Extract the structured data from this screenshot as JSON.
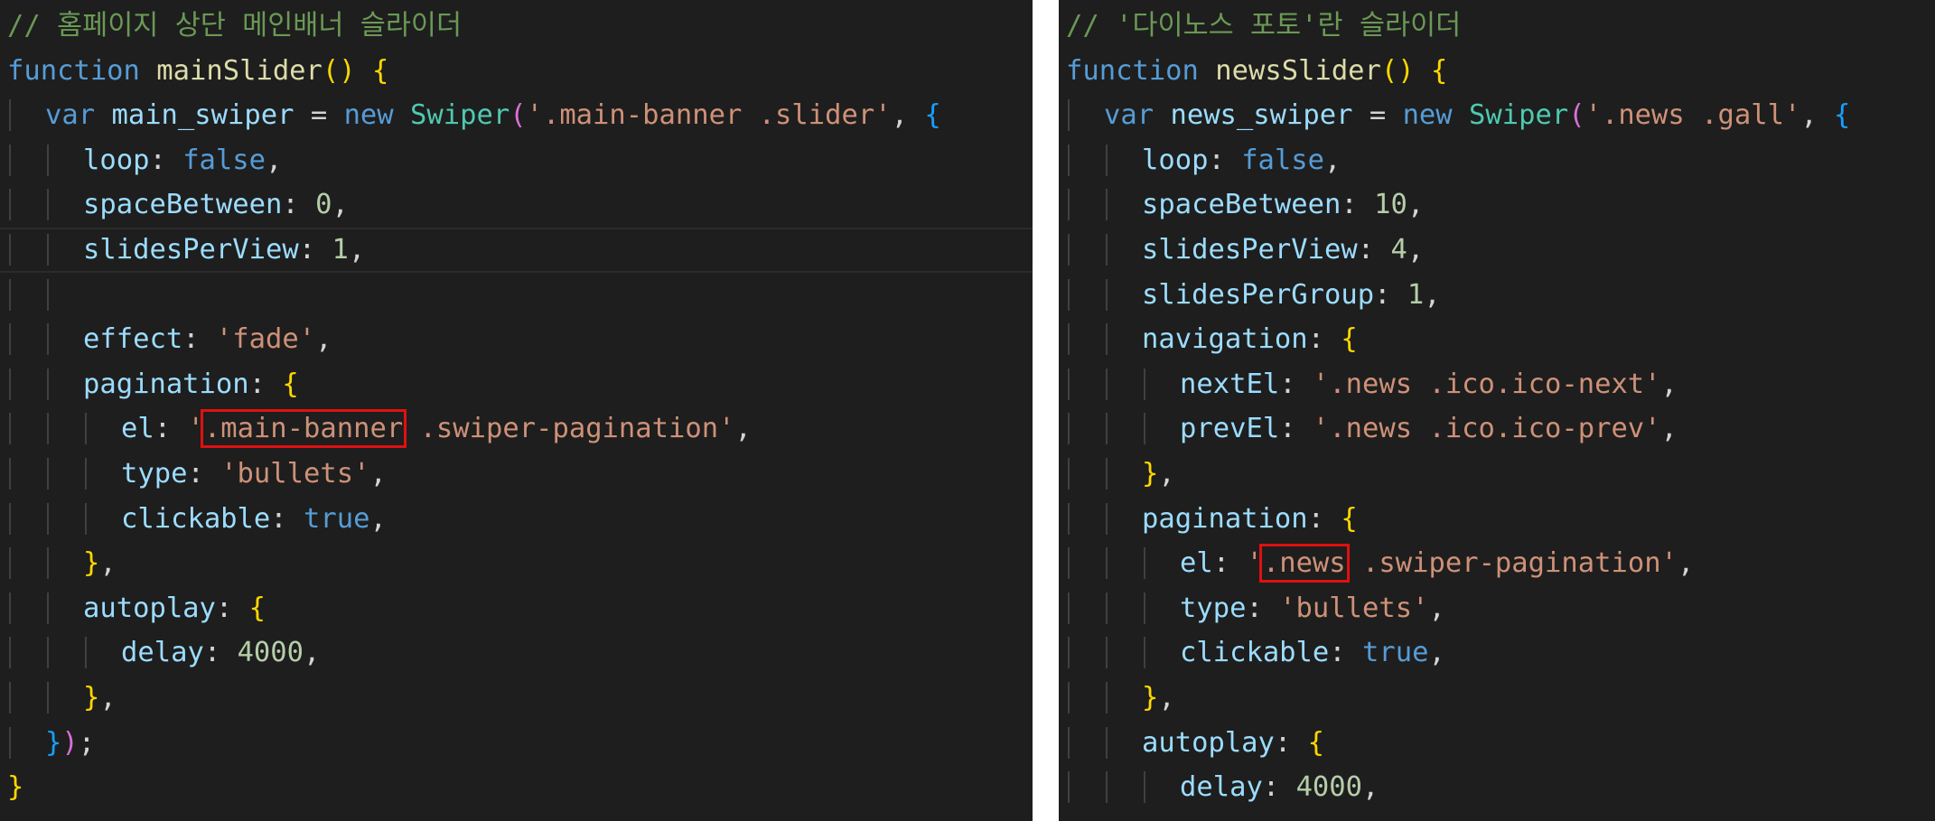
{
  "colors": {
    "background": "#1e1e1e",
    "comment": "#6a9955",
    "keyword": "#569cd6",
    "function": "#dcdcaa",
    "variable": "#9cdcfe",
    "string": "#ce9178",
    "number": "#b5cea8",
    "class": "#4ec9b0",
    "punctuation": "#d4d4d4",
    "bracket_level1": "#ffd700",
    "bracket_level2": "#da70d6",
    "bracket_level3": "#179fff",
    "highlight_box": "#e01010"
  },
  "panels": [
    {
      "id": "main-slider",
      "lines": [
        {
          "indent": 0,
          "tokens": [
            {
              "t": "// 홈페이지 상단 메인배너 슬라이더",
              "c": "comment"
            }
          ]
        },
        {
          "indent": 0,
          "tokens": [
            {
              "t": "function",
              "c": "kw"
            },
            {
              "t": " ",
              "c": "plain"
            },
            {
              "t": "mainSlider",
              "c": "fn"
            },
            {
              "t": "()",
              "c": "b1"
            },
            {
              "t": " ",
              "c": "plain"
            },
            {
              "t": "{",
              "c": "b1"
            }
          ]
        },
        {
          "indent": 1,
          "tokens": [
            {
              "t": "var",
              "c": "kw"
            },
            {
              "t": " ",
              "c": "plain"
            },
            {
              "t": "main_swiper",
              "c": "var"
            },
            {
              "t": " = ",
              "c": "plain"
            },
            {
              "t": "new",
              "c": "kw"
            },
            {
              "t": " ",
              "c": "plain"
            },
            {
              "t": "Swiper",
              "c": "class"
            },
            {
              "t": "(",
              "c": "b2"
            },
            {
              "t": "'.main-banner .slider'",
              "c": "str"
            },
            {
              "t": ", ",
              "c": "plain"
            },
            {
              "t": "{",
              "c": "b3"
            }
          ]
        },
        {
          "indent": 2,
          "tokens": [
            {
              "t": "loop",
              "c": "var"
            },
            {
              "t": ": ",
              "c": "plain"
            },
            {
              "t": "false",
              "c": "kw"
            },
            {
              "t": ",",
              "c": "plain"
            }
          ]
        },
        {
          "indent": 2,
          "tokens": [
            {
              "t": "spaceBetween",
              "c": "var"
            },
            {
              "t": ": ",
              "c": "plain"
            },
            {
              "t": "0",
              "c": "num"
            },
            {
              "t": ",",
              "c": "plain"
            }
          ]
        },
        {
          "indent": 2,
          "current": true,
          "tokens": [
            {
              "t": "slidesPerView",
              "c": "var"
            },
            {
              "t": ": ",
              "c": "plain"
            },
            {
              "t": "1",
              "c": "num"
            },
            {
              "t": ",",
              "c": "plain"
            }
          ]
        },
        {
          "indent": 2,
          "tokens": []
        },
        {
          "indent": 2,
          "tokens": [
            {
              "t": "effect",
              "c": "var"
            },
            {
              "t": ": ",
              "c": "plain"
            },
            {
              "t": "'fade'",
              "c": "str"
            },
            {
              "t": ",",
              "c": "plain"
            }
          ]
        },
        {
          "indent": 2,
          "tokens": [
            {
              "t": "pagination",
              "c": "var"
            },
            {
              "t": ": ",
              "c": "plain"
            },
            {
              "t": "{",
              "c": "b1"
            }
          ]
        },
        {
          "indent": 3,
          "tokens": [
            {
              "t": "el",
              "c": "var"
            },
            {
              "t": ": ",
              "c": "plain"
            },
            {
              "t": "'",
              "c": "str"
            },
            {
              "t": ".main-banner",
              "c": "str",
              "hl": true
            },
            {
              "t": " .swiper-pagination'",
              "c": "str"
            },
            {
              "t": ",",
              "c": "plain"
            }
          ]
        },
        {
          "indent": 3,
          "tokens": [
            {
              "t": "type",
              "c": "var"
            },
            {
              "t": ": ",
              "c": "plain"
            },
            {
              "t": "'bullets'",
              "c": "str"
            },
            {
              "t": ",",
              "c": "plain"
            }
          ]
        },
        {
          "indent": 3,
          "tokens": [
            {
              "t": "clickable",
              "c": "var"
            },
            {
              "t": ": ",
              "c": "plain"
            },
            {
              "t": "true",
              "c": "kw"
            },
            {
              "t": ",",
              "c": "plain"
            }
          ]
        },
        {
          "indent": 2,
          "tokens": [
            {
              "t": "}",
              "c": "b1"
            },
            {
              "t": ",",
              "c": "plain"
            }
          ]
        },
        {
          "indent": 2,
          "tokens": [
            {
              "t": "autoplay",
              "c": "var"
            },
            {
              "t": ": ",
              "c": "plain"
            },
            {
              "t": "{",
              "c": "b1"
            }
          ]
        },
        {
          "indent": 3,
          "tokens": [
            {
              "t": "delay",
              "c": "var"
            },
            {
              "t": ": ",
              "c": "plain"
            },
            {
              "t": "4000",
              "c": "num"
            },
            {
              "t": ",",
              "c": "plain"
            }
          ]
        },
        {
          "indent": 2,
          "tokens": [
            {
              "t": "}",
              "c": "b1"
            },
            {
              "t": ",",
              "c": "plain"
            }
          ]
        },
        {
          "indent": 1,
          "tokens": [
            {
              "t": "}",
              "c": "b3"
            },
            {
              "t": ")",
              "c": "b2"
            },
            {
              "t": ";",
              "c": "plain"
            }
          ]
        },
        {
          "indent": 0,
          "tokens": [
            {
              "t": "}",
              "c": "b1"
            }
          ]
        }
      ]
    },
    {
      "id": "news-slider",
      "lines": [
        {
          "indent": 0,
          "tokens": [
            {
              "t": "// '다이노스 포토'란 슬라이더",
              "c": "comment"
            }
          ]
        },
        {
          "indent": 0,
          "tokens": [
            {
              "t": "function",
              "c": "kw"
            },
            {
              "t": " ",
              "c": "plain"
            },
            {
              "t": "newsSlider",
              "c": "fn"
            },
            {
              "t": "()",
              "c": "b1"
            },
            {
              "t": " ",
              "c": "plain"
            },
            {
              "t": "{",
              "c": "b1"
            }
          ]
        },
        {
          "indent": 1,
          "tokens": [
            {
              "t": "var",
              "c": "kw"
            },
            {
              "t": " ",
              "c": "plain"
            },
            {
              "t": "news_swiper",
              "c": "var"
            },
            {
              "t": " = ",
              "c": "plain"
            },
            {
              "t": "new",
              "c": "kw"
            },
            {
              "t": " ",
              "c": "plain"
            },
            {
              "t": "Swiper",
              "c": "class"
            },
            {
              "t": "(",
              "c": "b2"
            },
            {
              "t": "'.news .gall'",
              "c": "str"
            },
            {
              "t": ", ",
              "c": "plain"
            },
            {
              "t": "{",
              "c": "b3"
            }
          ]
        },
        {
          "indent": 2,
          "tokens": [
            {
              "t": "loop",
              "c": "var"
            },
            {
              "t": ": ",
              "c": "plain"
            },
            {
              "t": "false",
              "c": "kw"
            },
            {
              "t": ",",
              "c": "plain"
            }
          ]
        },
        {
          "indent": 2,
          "tokens": [
            {
              "t": "spaceBetween",
              "c": "var"
            },
            {
              "t": ": ",
              "c": "plain"
            },
            {
              "t": "10",
              "c": "num"
            },
            {
              "t": ",",
              "c": "plain"
            }
          ]
        },
        {
          "indent": 2,
          "tokens": [
            {
              "t": "slidesPerView",
              "c": "var"
            },
            {
              "t": ": ",
              "c": "plain"
            },
            {
              "t": "4",
              "c": "num"
            },
            {
              "t": ",",
              "c": "plain"
            }
          ]
        },
        {
          "indent": 2,
          "tokens": [
            {
              "t": "slidesPerGroup",
              "c": "var"
            },
            {
              "t": ": ",
              "c": "plain"
            },
            {
              "t": "1",
              "c": "num"
            },
            {
              "t": ",",
              "c": "plain"
            }
          ]
        },
        {
          "indent": 2,
          "tokens": [
            {
              "t": "navigation",
              "c": "var"
            },
            {
              "t": ": ",
              "c": "plain"
            },
            {
              "t": "{",
              "c": "b1"
            }
          ]
        },
        {
          "indent": 3,
          "tokens": [
            {
              "t": "nextEl",
              "c": "var"
            },
            {
              "t": ": ",
              "c": "plain"
            },
            {
              "t": "'.news .ico.ico-next'",
              "c": "str"
            },
            {
              "t": ",",
              "c": "plain"
            }
          ]
        },
        {
          "indent": 3,
          "tokens": [
            {
              "t": "prevEl",
              "c": "var"
            },
            {
              "t": ": ",
              "c": "plain"
            },
            {
              "t": "'.news .ico.ico-prev'",
              "c": "str"
            },
            {
              "t": ",",
              "c": "plain"
            }
          ]
        },
        {
          "indent": 2,
          "tokens": [
            {
              "t": "}",
              "c": "b1"
            },
            {
              "t": ",",
              "c": "plain"
            }
          ]
        },
        {
          "indent": 2,
          "tokens": [
            {
              "t": "pagination",
              "c": "var"
            },
            {
              "t": ": ",
              "c": "plain"
            },
            {
              "t": "{",
              "c": "b1"
            }
          ]
        },
        {
          "indent": 3,
          "tokens": [
            {
              "t": "el",
              "c": "var"
            },
            {
              "t": ": ",
              "c": "plain"
            },
            {
              "t": "'",
              "c": "str"
            },
            {
              "t": ".news",
              "c": "str",
              "hl": true
            },
            {
              "t": " .swiper-pagination'",
              "c": "str"
            },
            {
              "t": ",",
              "c": "plain"
            }
          ]
        },
        {
          "indent": 3,
          "tokens": [
            {
              "t": "type",
              "c": "var"
            },
            {
              "t": ": ",
              "c": "plain"
            },
            {
              "t": "'bullets'",
              "c": "str"
            },
            {
              "t": ",",
              "c": "plain"
            }
          ]
        },
        {
          "indent": 3,
          "tokens": [
            {
              "t": "clickable",
              "c": "var"
            },
            {
              "t": ": ",
              "c": "plain"
            },
            {
              "t": "true",
              "c": "kw"
            },
            {
              "t": ",",
              "c": "plain"
            }
          ]
        },
        {
          "indent": 2,
          "tokens": [
            {
              "t": "}",
              "c": "b1"
            },
            {
              "t": ",",
              "c": "plain"
            }
          ]
        },
        {
          "indent": 2,
          "tokens": [
            {
              "t": "autoplay",
              "c": "var"
            },
            {
              "t": ": ",
              "c": "plain"
            },
            {
              "t": "{",
              "c": "b1"
            }
          ]
        },
        {
          "indent": 3,
          "tokens": [
            {
              "t": "delay",
              "c": "var"
            },
            {
              "t": ": ",
              "c": "plain"
            },
            {
              "t": "4000",
              "c": "num"
            },
            {
              "t": ",",
              "c": "plain"
            }
          ]
        }
      ]
    }
  ]
}
